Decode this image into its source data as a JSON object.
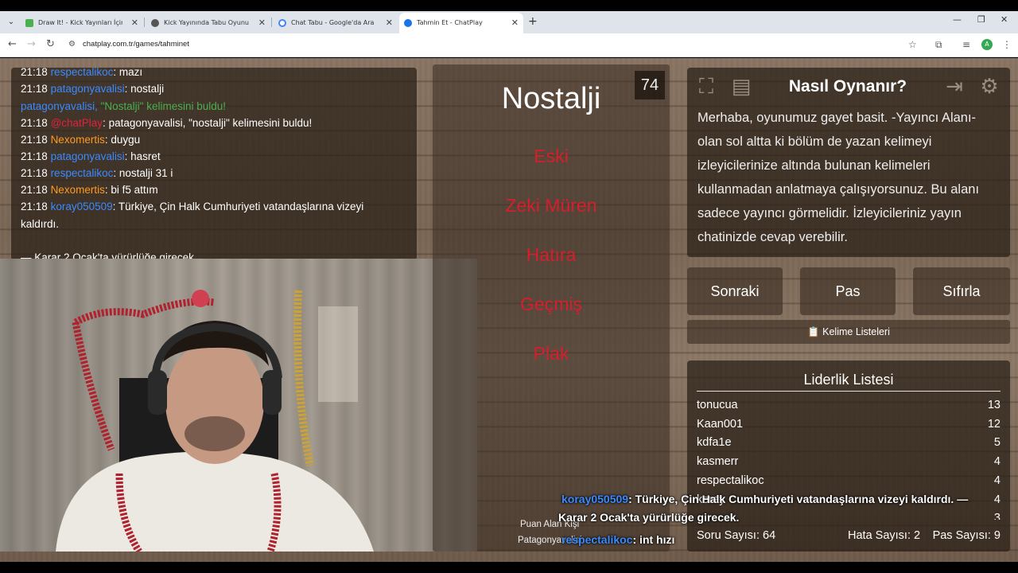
{
  "browser": {
    "tabs": [
      {
        "title": "Draw It! - Kick Yayınları İçin Çizim",
        "favicon_color": "#4caf50"
      },
      {
        "title": "Kick Yayınında Tabu Oyunu",
        "favicon_color": "#555555"
      },
      {
        "title": "Chat Tabu - Google'da Ara",
        "favicon_color": "#4285f4"
      },
      {
        "title": "Tahmin Et - ChatPlay",
        "favicon_color": "#1a73e8",
        "active": true
      }
    ],
    "close_glyph": "✕",
    "new_tab": "+",
    "window_controls": [
      "—",
      "❐",
      "✕"
    ],
    "url": "chatplay.com.tr/games/tahminet",
    "avatar_letter": "A"
  },
  "chat": {
    "lines": [
      {
        "time": "21:18",
        "user": "respectalikoc",
        "color": "blue",
        "sep": ": ",
        "msg": "mazı"
      },
      {
        "time": "21:18",
        "user": "patagonyavalisi",
        "color": "blue",
        "sep": ": ",
        "msg": "nostalji"
      },
      {
        "time": "",
        "user": "patagonyavalisi,",
        "color": "blue",
        "sep": " ",
        "msg": "\"Nostalji\" kelimesini buldu!",
        "msg_color": "green"
      },
      {
        "time": "21:18",
        "user": "@chatPlay",
        "color": "red",
        "sep": ": ",
        "msg": "patagonyavalisi, \"nostalji\" kelimesini buldu!"
      },
      {
        "time": "21:18",
        "user": "Nexomertis",
        "color": "orange",
        "sep": ": ",
        "msg": "duygu"
      },
      {
        "time": "21:18",
        "user": "patagonyavalisi",
        "color": "blue",
        "sep": ": ",
        "msg": "hasret"
      },
      {
        "time": "21:18",
        "user": "respectalikoc",
        "color": "blue",
        "sep": ": ",
        "msg": "nostalji 31 i"
      },
      {
        "time": "21:18",
        "user": "Nexomertis",
        "color": "orange",
        "sep": ": ",
        "msg": "bi f5 attım"
      },
      {
        "time": "21:18",
        "user": "koray050509",
        "color": "blue",
        "sep": ": ",
        "msg": "Türkiye, Çin Halk Cumhuriyeti vatandaşlarına vizeyi"
      }
    ],
    "wrap_line": "kaldırdı.",
    "cut_line": "— Karar 2 Ocak'ta yürürlüğe girecek."
  },
  "game": {
    "timer": "74",
    "word": "Nostalji",
    "taboo_words": [
      "Eski",
      "Zeki Müren",
      "Hatıra",
      "Geçmiş",
      "Plak"
    ],
    "score_label": "Puan Alan Kişi",
    "score_name": "Patagonyavalisi"
  },
  "howto": {
    "title": "Nasıl Oynanır?",
    "text": "Merhaba, oyunumuz gayet basit. -Yayıncı Alanı- olan sol altta ki bölüm de yazan kelimeyi izleyicilerinize altında bulunan kelimeleri kullanmadan anlatmaya çalışıyorsunuz. Bu alanı sadece yayıncı görmelidir. İzleyicileriniz yayın chatinizde cevap verebilir.",
    "icons": [
      "fullscreen-icon",
      "document-icon",
      "exit-icon",
      "gear-icon"
    ]
  },
  "controls": {
    "next": "Sonraki",
    "pass": "Pas",
    "reset": "Sıfırla",
    "word_lists": "Kelime Listeleri",
    "word_lists_icon": "📋"
  },
  "leaderboard": {
    "title": "Liderlik Listesi",
    "rows": [
      {
        "name": "tonucua",
        "score": "13"
      },
      {
        "name": "Kaan001",
        "score": "12"
      },
      {
        "name": "kdfa1e",
        "score": "5"
      },
      {
        "name": "kasmerr",
        "score": "4"
      },
      {
        "name": "respectalikoc",
        "score": "4"
      },
      {
        "name": "koray",
        "score": "4"
      },
      {
        "name": "",
        "score": "3"
      }
    ],
    "question_count": "Soru Sayısı: 64",
    "error_count": "Hata Sayısı: 2",
    "pass_count": "Pas Sayısı: 9"
  },
  "overlay": {
    "user1": "koray050509",
    "msg1": ": Türkiye, Çin Halk Cumhuriyeti vatandaşlarına vizeyi kaldırdı. —",
    "msg1b": "Karar 2 Ocak'ta yürürlüğe girecek.",
    "user2": "respectalikoc",
    "msg2": ": int hızı"
  }
}
